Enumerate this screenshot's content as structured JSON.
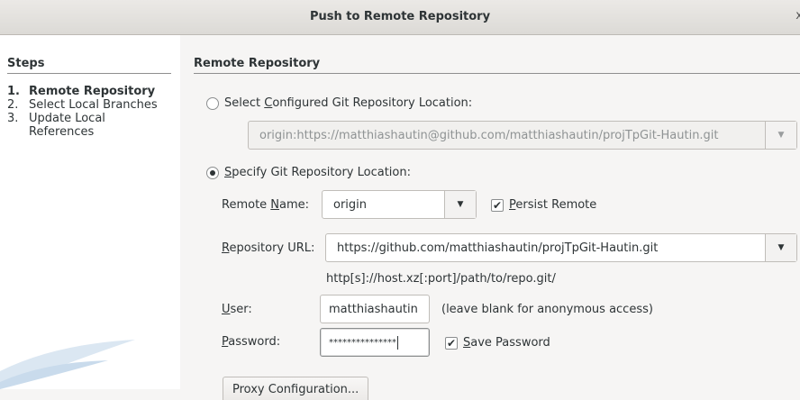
{
  "window": {
    "title": "Push to Remote Repository",
    "close_glyph": "x"
  },
  "steps": {
    "heading": "Steps",
    "items": [
      {
        "num": "1.",
        "label": "Remote Repository"
      },
      {
        "num": "2.",
        "label": "Select Local Branches"
      },
      {
        "num": "3.",
        "label": "Update Local References"
      }
    ]
  },
  "main": {
    "section_title": "Remote Repository",
    "configured_option": {
      "label_pre": "Select ",
      "label_mnemonic": "C",
      "label_post": "onfigured Git Repository Location:",
      "selected": false,
      "combo_value": "origin:https://matthiashautin@github.com/matthiashautin/projTpGit-Hautin.git"
    },
    "specify_option": {
      "label_mnemonic": "S",
      "label_post": "pecify Git Repository Location:",
      "selected": true
    },
    "remote_name": {
      "label_pre": "Remote ",
      "label_mnemonic": "N",
      "label_post": "ame:",
      "value": "origin"
    },
    "persist_remote": {
      "mnemonic": "P",
      "label_post": "ersist Remote",
      "checked": true
    },
    "repository_url": {
      "label_mnemonic": "R",
      "label_post": "epository URL:",
      "value": "https://github.com/matthiashautin/projTpGit-Hautin.git",
      "hint": "http[s]://host.xz[:port]/path/to/repo.git/"
    },
    "user": {
      "label_mnemonic": "U",
      "label_post": "ser:",
      "value": "matthiashautin",
      "hint": "(leave blank for anonymous access)"
    },
    "password": {
      "label_mnemonic": "P",
      "label_post": "assword:",
      "value": "***************"
    },
    "save_password": {
      "mnemonic": "S",
      "label_post": "ave Password",
      "checked": true
    },
    "proxy_button": {
      "label": "Proxy Configuration..."
    }
  },
  "colors": {
    "accent": "#2e3436",
    "sidebar_bg": "#ffffff",
    "window_bg": "#f6f5f4"
  }
}
